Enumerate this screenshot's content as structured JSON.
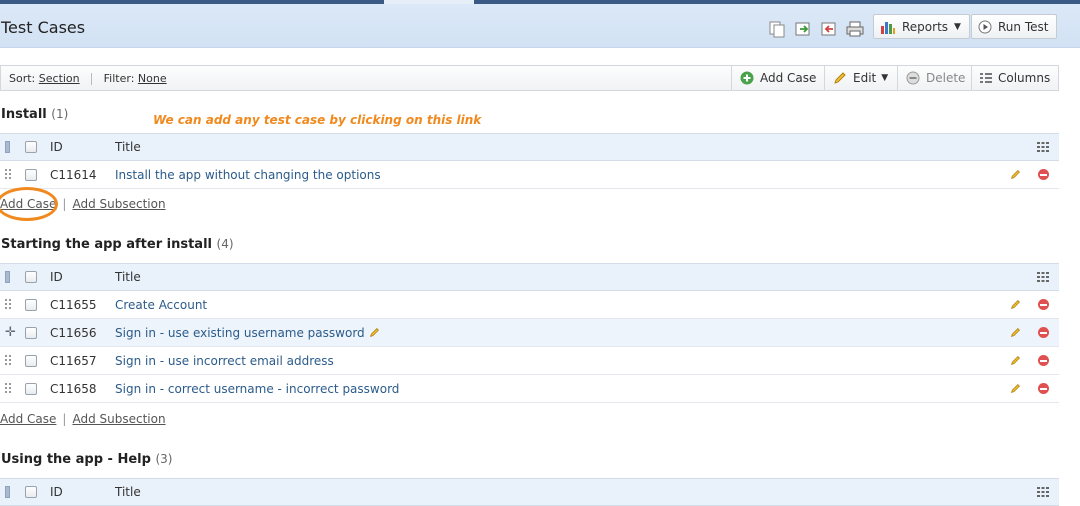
{
  "header": {
    "title": "Test Cases",
    "reports_label": "Reports",
    "run_test_label": "Run Test"
  },
  "toolbar": {
    "sort_prefix": "Sort:",
    "sort_value": "Section",
    "filter_prefix": "Filter:",
    "filter_value": "None",
    "add_case": "Add Case",
    "edit": "Edit",
    "delete": "Delete",
    "columns": "Columns"
  },
  "annotation": "We can add any test case by clicking on this link",
  "table_header": {
    "id": "ID",
    "title": "Title"
  },
  "sections": [
    {
      "name": "Install",
      "count": "(1)",
      "cases": [
        {
          "id": "C11614",
          "title": "Install the app without changing the options"
        }
      ],
      "add_case": "Add Case",
      "add_subsection": "Add Subsection"
    },
    {
      "name": "Starting the app after install",
      "count": "(4)",
      "cases": [
        {
          "id": "C11655",
          "title": "Create Account"
        },
        {
          "id": "C11656",
          "title": "Sign in - use existing username password"
        },
        {
          "id": "C11657",
          "title": "Sign in - use incorrect email address"
        },
        {
          "id": "C11658",
          "title": "Sign in - correct username - incorrect password"
        }
      ],
      "add_case": "Add Case",
      "add_subsection": "Add Subsection"
    },
    {
      "name": "Using the app - Help",
      "count": "(3)"
    }
  ],
  "colors": {
    "accent": "#2b5b8a",
    "annotation": "#f0891e",
    "header_bg": "#dbe8f7"
  }
}
